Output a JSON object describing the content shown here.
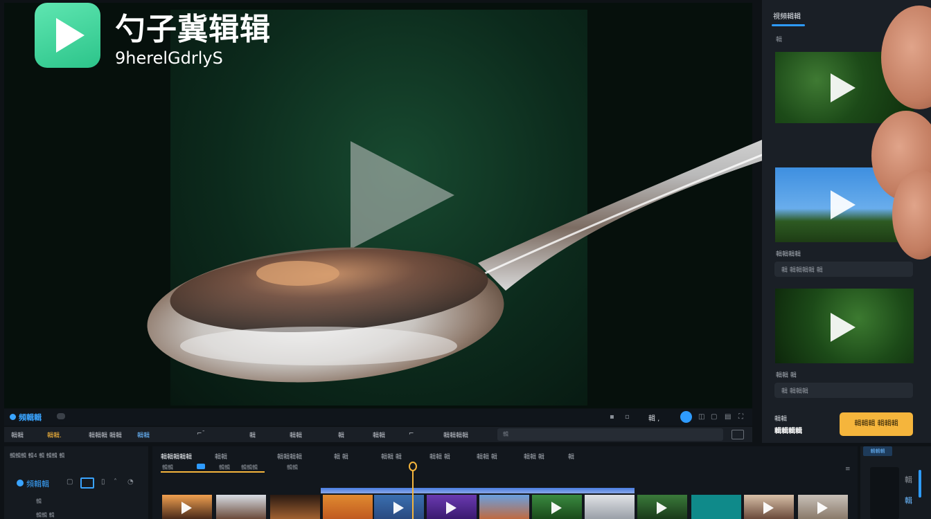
{
  "app": {
    "title": "勺子冀辑辑",
    "subtitle": "9herelGdrlyS"
  },
  "right_panel": {
    "tab_label": "視頻輯輯",
    "small_label": "輯",
    "thumb_2_label": "輯輯輯輯",
    "field_1_value": "輯 輯輯輯輯 輯",
    "thumb_3_label": "輯輯 輯",
    "field_2_value": "輯 輯輯輯",
    "bottom_a": "輯輯",
    "bottom_b": "輯輯輯輯",
    "export_label": "輯輯輯 輯輯輯"
  },
  "control_bar": {
    "brand": "頻輯輯",
    "time": "輯 ,"
  },
  "toolbar": {
    "items": [
      "輯輯",
      "輯輯.",
      "輯輯輯 輯輯",
      "輯輯",
      "⌐ˉ",
      "輯",
      "輯輯",
      "輯",
      "輯輯",
      "⌐",
      "輯輯輯輯"
    ],
    "search_placeholder": "輯"
  },
  "bottom_left": {
    "header": "輯輯輯 輯4 輯 輯輯 輯",
    "brand": "頻輯輯",
    "sub_a": "輯",
    "sub_b": "輯輯 輯"
  },
  "timeline": {
    "tabs": [
      "輯輯輯輯輯",
      "輯輯",
      "輯輯輯輯",
      "輯 輯",
      "輯輯 輯",
      "輯輯 輯",
      "輯輯 輯",
      "輯輯 輯",
      "輯輯 輯",
      "輯"
    ],
    "subtabs": [
      "輯輯",
      "輯輯",
      "輯輯輯",
      "輯輯"
    ],
    "menu": "≡"
  },
  "far_right": {
    "tag": "輯輯輯",
    "icon_1": "輯",
    "icon_2": "輯"
  },
  "colors": {
    "accent": "#2e9bff",
    "export": "#f5b53c",
    "logo": "#3ed49b"
  }
}
